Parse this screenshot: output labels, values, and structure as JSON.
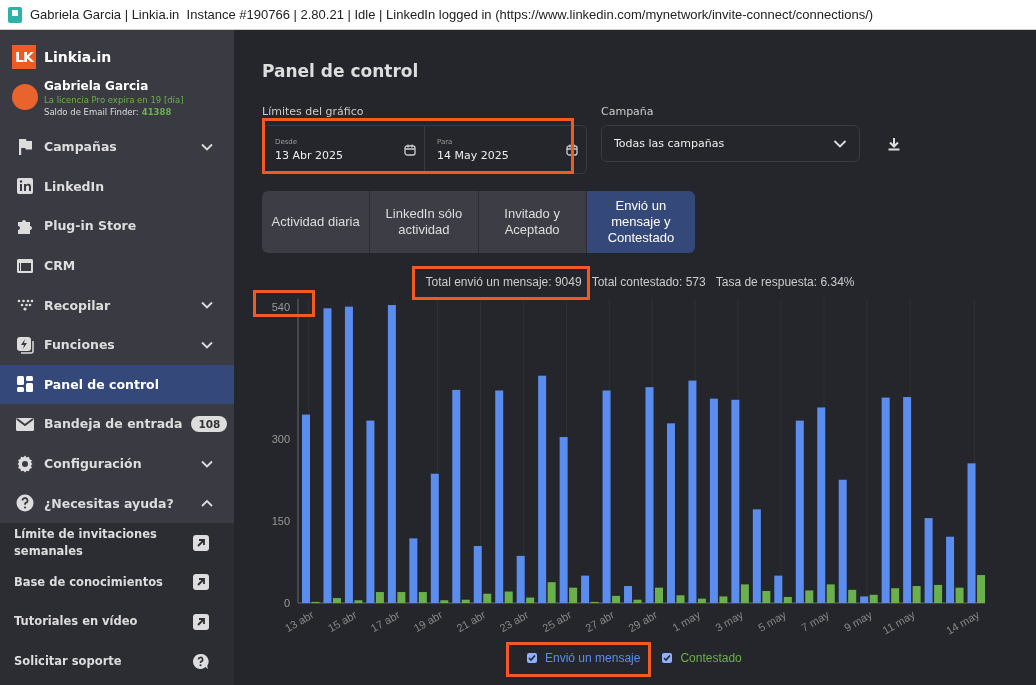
{
  "window": {
    "title": "Gabriela Garcia | Linkia.in  Instance #190766 | 2.80.21 | Idle | LinkedIn logged in (https://www.linkedin.com/mynetwork/invite-connect/connections/)"
  },
  "sidebar": {
    "brand": "Linkia.in",
    "logo_text": "LK",
    "user": {
      "name": "Gabriela Garcia",
      "license": "La licencia Pro expira en 19 [día]",
      "email_finder_label": "Saldo de Email Finder:",
      "email_finder_value": "41388"
    },
    "items": [
      {
        "label": "Campañas",
        "selected": false,
        "expanded": false
      },
      {
        "label": "LinkedIn",
        "selected": false
      },
      {
        "label": "Plug-in Store",
        "selected": false
      },
      {
        "label": "CRM",
        "selected": false
      },
      {
        "label": "Recopilar",
        "selected": false,
        "expanded": false
      },
      {
        "label": "Funciones",
        "selected": false,
        "expanded": false
      },
      {
        "label": "Panel de control",
        "selected": true
      },
      {
        "label": "Bandeja de entrada",
        "selected": false,
        "badge": "108"
      },
      {
        "label": "Configuración",
        "selected": false,
        "expanded": false
      },
      {
        "label": "¿Necesitas ayuda?",
        "selected": false,
        "expanded": true,
        "children": [
          {
            "label": "Límite de invitaciones semanales",
            "kind": "link"
          },
          {
            "label": "Base de conocimientos",
            "kind": "link"
          },
          {
            "label": "Tutoriales en vídeo",
            "kind": "link"
          },
          {
            "label": "Solicitar soporte",
            "kind": "help"
          }
        ]
      }
    ]
  },
  "main": {
    "title": "Panel de control",
    "range_label": "Límites del gráfico",
    "from": {
      "label": "Desde",
      "value": "13 Abr 2025"
    },
    "to": {
      "label": "Para",
      "value": "14 May 2025"
    },
    "campaign": {
      "label": "Campaña",
      "value": "Todas las campañas"
    },
    "tabs": [
      {
        "label": "Actividad diaria",
        "selected": false
      },
      {
        "label": "LinkedIn sólo actividad",
        "selected": false
      },
      {
        "label": "Invitado y Aceptado",
        "selected": false
      },
      {
        "label": "Envió un mensaje y Contestado",
        "selected": true
      }
    ],
    "stats": [
      "Total envió un mensaje: 9049",
      "Total contestado: 573",
      "Tasa de respuesta: 6.34%"
    ],
    "chart_data": {
      "type": "bar",
      "grid": true,
      "categories": [
        "13 abr",
        null,
        "15 abr",
        null,
        "17 abr",
        null,
        "19 abr",
        null,
        "21 abr",
        null,
        "23 abr",
        null,
        "25 abr",
        null,
        "27 abr",
        null,
        "29 abr",
        null,
        "1 may",
        null,
        "3 may",
        null,
        "5 may",
        null,
        "7 may",
        null,
        "9 may",
        null,
        "11 may",
        null,
        null,
        "14 may"
      ],
      "series": [
        {
          "name": "Envió un mensaje",
          "color": "#5b8def",
          "values": [
            344,
            538,
            541,
            333,
            544,
            118,
            236,
            389,
            104,
            388,
            86,
            415,
            303,
            50,
            388,
            31,
            394,
            328,
            406,
            373,
            371,
            171,
            50,
            333,
            357,
            225,
            12,
            375,
            376,
            155,
            121,
            255
          ]
        },
        {
          "name": "Contestado",
          "color": "#6ab04c",
          "values": [
            2,
            9,
            5,
            20,
            20,
            20,
            5,
            6,
            17,
            21,
            10,
            38,
            28,
            2,
            13,
            6,
            28,
            14,
            8,
            12,
            34,
            22,
            11,
            23,
            34,
            24,
            15,
            27,
            31,
            33,
            28,
            51
          ]
        }
      ],
      "ylim": [
        0,
        555
      ],
      "yticks": [
        0,
        150,
        300,
        540
      ]
    },
    "legend": [
      {
        "checked": true
      },
      {
        "checked": true
      }
    ]
  }
}
